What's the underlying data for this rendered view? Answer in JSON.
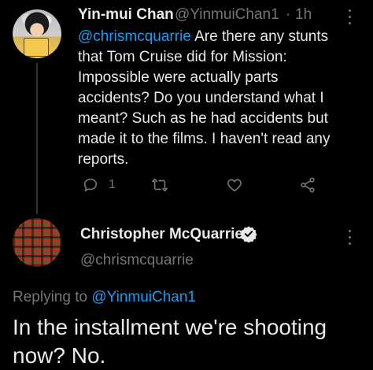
{
  "tweet1": {
    "author_name": "Yin-mui Chan",
    "author_handle": "@YinmuiChan1",
    "separator": "·",
    "time": "1h",
    "mention": "@chrismcquarrie",
    "text": " Are there any stunts that Tom Cruise did for Mission: Impossible were actually parts accidents?  Do you understand what I meant?  Such as he had accidents but made it to the films.  I haven't read any reports.",
    "reply_count": "1",
    "icons": {
      "reply": "reply-icon",
      "retweet": "retweet-icon",
      "like": "heart-icon",
      "share": "share-icon",
      "more": "more-options-icon"
    }
  },
  "tweet2": {
    "author_name": "Christopher McQuarrie",
    "author_handle": "@chrismcquarrie",
    "replying_prefix": "Replying to ",
    "replying_handle": "@YinmuiChan1",
    "text": "In the installment we're shooting now? No.",
    "icons": {
      "verified": "verified-badge-icon",
      "more": "more-options-icon"
    }
  },
  "colors": {
    "background": "#000000",
    "text": "#e7e9ea",
    "secondary": "#71767b",
    "accent": "#1d9bf0"
  }
}
